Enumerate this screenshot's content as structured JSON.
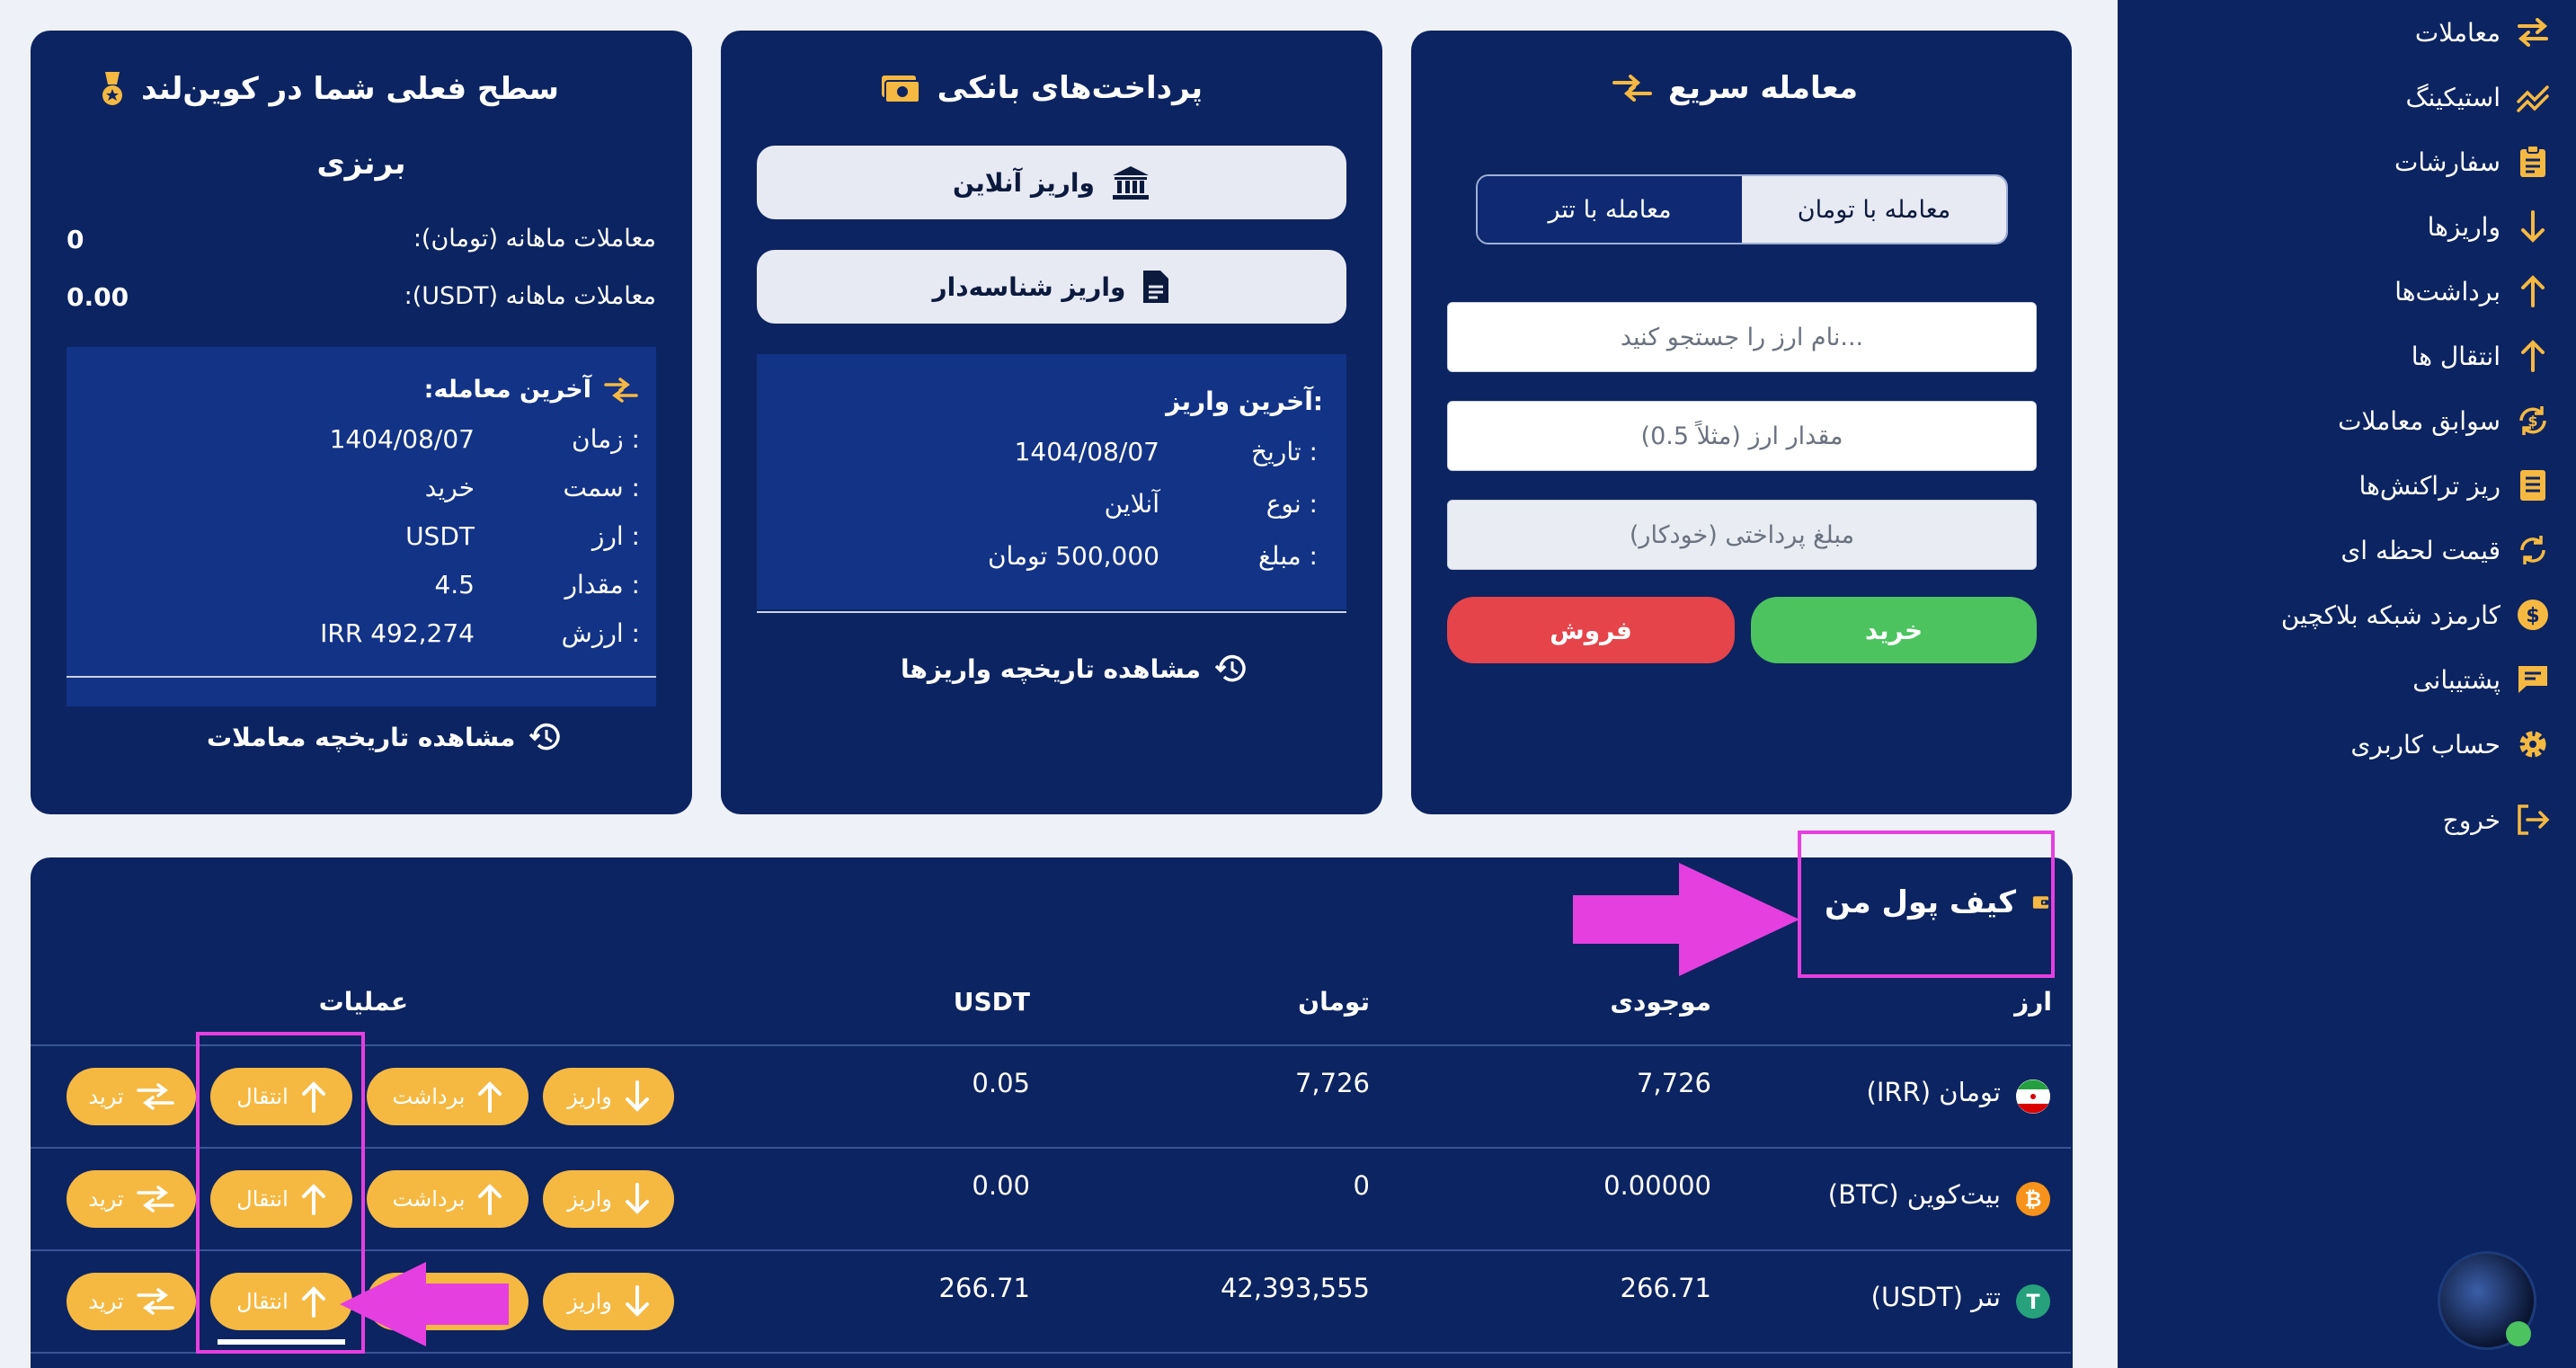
{
  "sidebar": {
    "items": [
      {
        "label": "معاملات",
        "icon": "swap-icon"
      },
      {
        "label": "استیکینگ",
        "icon": "trend-icon"
      },
      {
        "label": "سفارشات",
        "icon": "clipboard-icon"
      },
      {
        "label": "واریزها",
        "icon": "arrow-down-icon"
      },
      {
        "label": "برداشت‌ها",
        "icon": "arrow-up-icon"
      },
      {
        "label": "انتقال ها",
        "icon": "arrow-up-icon"
      },
      {
        "label": "سوابق معاملات",
        "icon": "dollar-refresh-icon"
      },
      {
        "label": "ریز تراکنش‌ها",
        "icon": "list-icon"
      },
      {
        "label": "قیمت لحظه ای",
        "icon": "sync-icon"
      },
      {
        "label": "کارمزد شبکه بلاکچین",
        "icon": "coin-icon"
      },
      {
        "label": "پشتیبانی",
        "icon": "chat-icon"
      },
      {
        "label": "حساب کاربری",
        "icon": "gear-icon"
      },
      {
        "label": "خروج",
        "icon": "logout-icon"
      }
    ]
  },
  "quick_trade": {
    "title": "معامله سریع",
    "tab_toman": "معامله با تومان",
    "tab_tether": "معامله با تتر",
    "search_placeholder": "نام ارز را جستجو کنید...",
    "amount_placeholder": "مقدار ارز (مثلاً 0.5)",
    "payment_placeholder": "مبلغ پرداختی (خودکار)",
    "buy": "خرید",
    "sell": "فروش"
  },
  "bank": {
    "title": "پرداخت‌های بانکی",
    "online_deposit": "واریز آنلاین",
    "id_deposit": "واریز شناسه‌دار",
    "last_title": "آخرین واریز:",
    "date_label": "تاریخ :",
    "date_value": "1404/08/07",
    "type_label": "نوع :",
    "type_value": "آنلاین",
    "amount_label": "مبلغ :",
    "amount_value": "500,000 تومان",
    "history_link": "مشاهده تاریخچه واریزها"
  },
  "level": {
    "title": "سطح فعلی شما در کوین‌لند",
    "level_name": "برنزی",
    "monthly_toman_label": "معاملات ماهانه (تومان):",
    "monthly_toman_value": "0",
    "monthly_usdt_label": "معاملات ماهانه (USDT):",
    "monthly_usdt_value": "0.00",
    "last_trade_title": "آخرین معامله:",
    "time_label": "زمان :",
    "time_value": "1404/08/07",
    "side_label": "سمت :",
    "side_value": "خرید",
    "currency_label": "ارز :",
    "currency_value": "USDT",
    "qty_label": "مقدار :",
    "qty_value": "4.5",
    "worth_label": "ارزش :",
    "worth_value": "IRR 492,274",
    "history_link": "مشاهده تاریخچه معاملات"
  },
  "wallet": {
    "title": "کیف پول من",
    "headers": {
      "currency": "ارز",
      "balance": "موجودی",
      "toman": "تومان",
      "usdt": "USDT",
      "ops": "عملیات"
    },
    "rows": [
      {
        "name": "تومان (IRR)",
        "balance": "7,726",
        "toman": "7,726",
        "usdt": "0.05",
        "coin_icon": "iran-flag-icon"
      },
      {
        "name": "بیت‌کوین (BTC)",
        "balance": "0.00000",
        "toman": "0",
        "usdt": "0.00",
        "coin_icon": "bitcoin-icon"
      },
      {
        "name": "تتر (USDT)",
        "balance": "266.71",
        "toman": "42,393,555",
        "usdt": "266.71",
        "coin_icon": "tether-icon"
      }
    ],
    "actions": {
      "deposit": "واریز",
      "withdraw": "برداشت",
      "transfer": "انتقال",
      "trade": "ترید"
    }
  },
  "colors": {
    "navy": "#0c2461",
    "accent": "#f5b942",
    "buy": "#4cc35f",
    "sell": "#e5444a",
    "highlight": "#e53fe0"
  }
}
